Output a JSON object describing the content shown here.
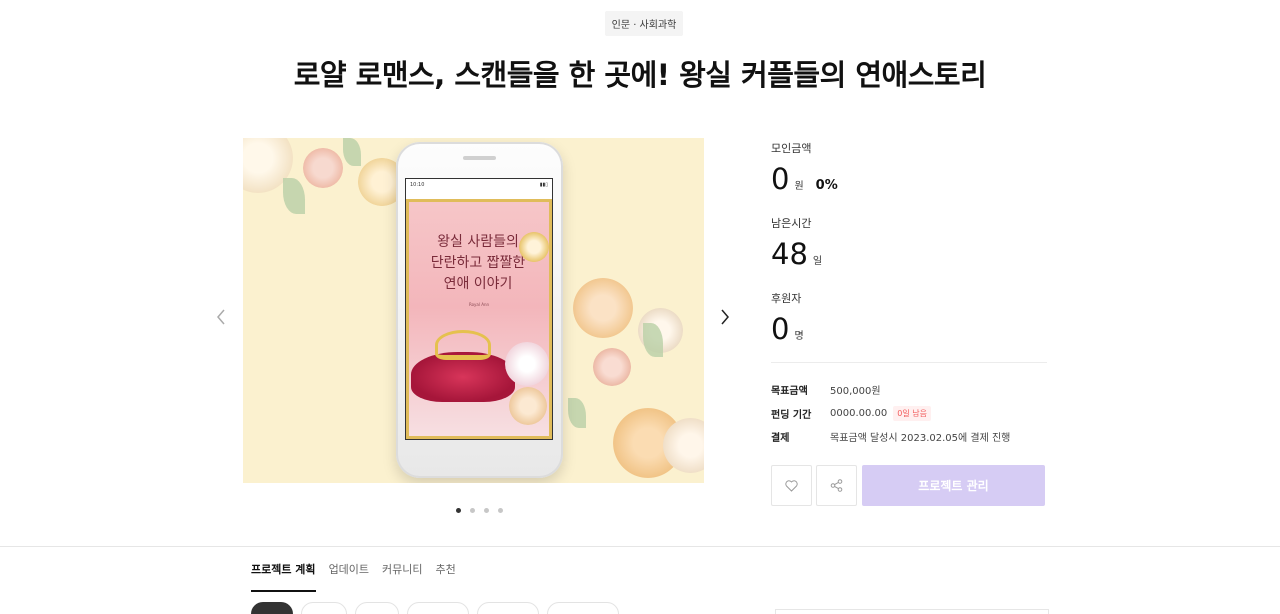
{
  "category": "인문 · 사회과학",
  "title": "로얄 로맨스, 스캔들을 한 곳에! 왕실 커플들의 연애스토리",
  "gallery": {
    "status_time": "10:10",
    "cover_title_line1": "왕실 사람들의",
    "cover_title_line2": "단란하고 짭짤한",
    "cover_title_line3": "연애 이야기",
    "cover_subtitle": "Royal Ann",
    "slide_count": 4,
    "active_slide": 1
  },
  "stats": {
    "raised_label": "모인금액",
    "raised_value": "0",
    "raised_unit": "원",
    "raised_percent": "0%",
    "time_label": "남은시간",
    "time_value": "48",
    "time_unit": "일",
    "backers_label": "후원자",
    "backers_value": "0",
    "backers_unit": "명"
  },
  "info": {
    "goal_key": "목표금액",
    "goal_value": "500,000원",
    "period_key": "펀딩 기간",
    "period_value": "0000.00.00",
    "period_badge": "0일 남음",
    "payment_key": "결제",
    "payment_value": "목표금액 달성시 2023.02.05에 결제 진행"
  },
  "actions": {
    "like_icon": "heart-icon",
    "share_icon": "share-icon",
    "manage_label": "프로젝트 관리"
  },
  "tabs": [
    {
      "label": "프로젝트 계획",
      "active": true
    },
    {
      "label": "업데이트",
      "active": false
    },
    {
      "label": "커뮤니티",
      "active": false
    },
    {
      "label": "추천",
      "active": false
    }
  ],
  "colors": {
    "accent": "#d6ccf4",
    "badge_text": "#f25b5b",
    "gallery_bg": "#fbf1cf"
  }
}
